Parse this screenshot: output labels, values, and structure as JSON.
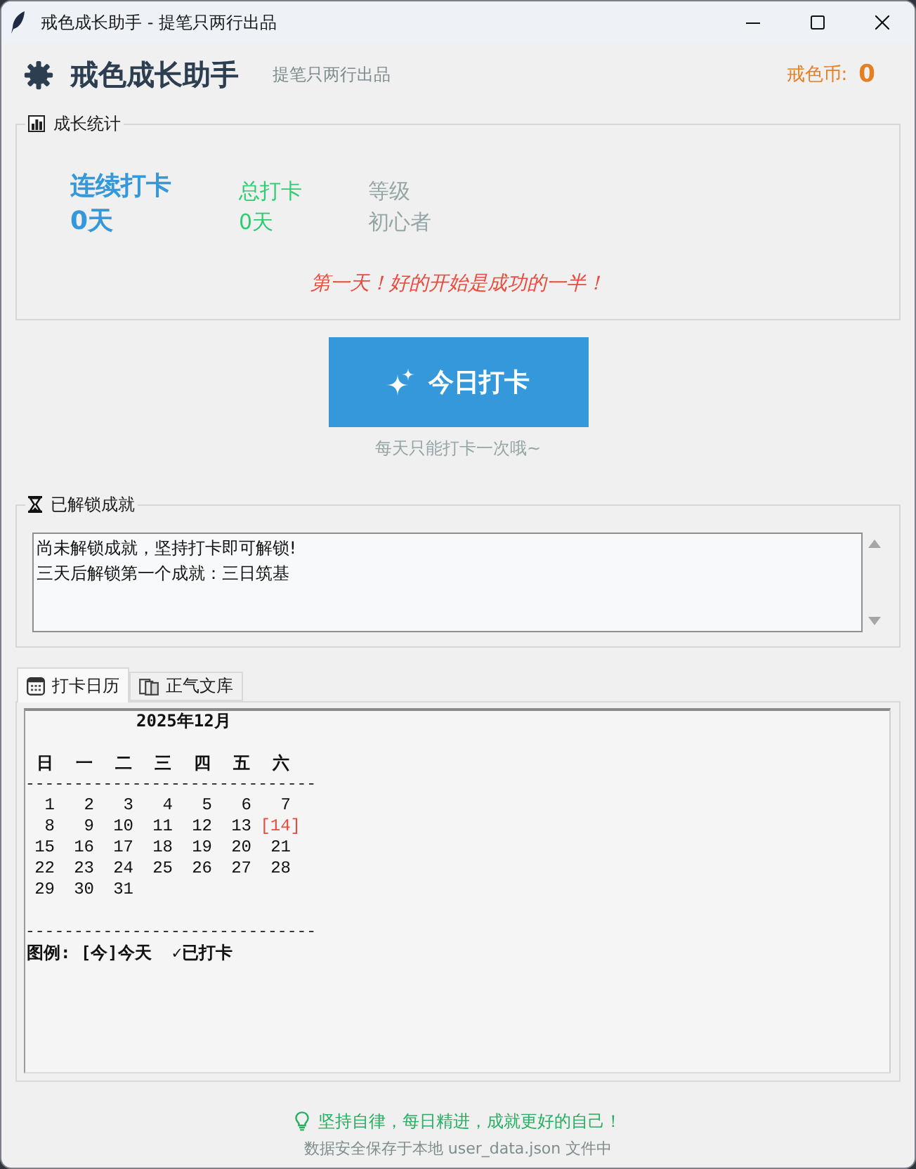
{
  "window": {
    "title": "戒色成长助手 - 提笔只两行出品"
  },
  "header": {
    "title": "戒色成长助手",
    "subtitle": "提笔只两行出品",
    "coins_label": "戒色币:",
    "coins": "0"
  },
  "stats": {
    "title": "成长统计",
    "items": [
      {
        "kind": "streak",
        "label": "连续打卡",
        "value": "0天"
      },
      {
        "kind": "total",
        "label": "总打卡",
        "value": "0天"
      },
      {
        "kind": "level",
        "label": "等级",
        "value": "初心者"
      }
    ],
    "message": "第一天！好的开始是成功的一半！"
  },
  "checkin": {
    "button": "今日打卡",
    "hint": "每天只能打卡一次哦~"
  },
  "achievements": {
    "title": "已解锁成就",
    "lines": [
      "尚未解锁成就，坚持打卡即可解锁!",
      "三天后解锁第一个成就：三日筑基"
    ]
  },
  "tabs": [
    {
      "label": "打卡日历",
      "selected": true
    },
    {
      "label": "正气文库",
      "selected": false
    }
  ],
  "calendar": {
    "month": "2025年12月",
    "weekdays": [
      "日",
      "一",
      "二",
      "三",
      "四",
      "五",
      "六"
    ],
    "rule_top": "------------------------------",
    "weeks": [
      [
        {
          "day": "1",
          "today": false
        },
        {
          "day": "2",
          "today": false
        },
        {
          "day": "3",
          "today": false
        },
        {
          "day": "4",
          "today": false
        },
        {
          "day": "5",
          "today": false
        },
        {
          "day": "6",
          "today": false
        },
        {
          "day": "7",
          "today": false
        }
      ],
      [
        {
          "day": "8",
          "today": false
        },
        {
          "day": "9",
          "today": false
        },
        {
          "day": "10",
          "today": false
        },
        {
          "day": "11",
          "today": false
        },
        {
          "day": "12",
          "today": false
        },
        {
          "day": "13",
          "today": false
        },
        {
          "day": "[14]",
          "today": true
        }
      ],
      [
        {
          "day": "15",
          "today": false
        },
        {
          "day": "16",
          "today": false
        },
        {
          "day": "17",
          "today": false
        },
        {
          "day": "18",
          "today": false
        },
        {
          "day": "19",
          "today": false
        },
        {
          "day": "20",
          "today": false
        },
        {
          "day": "21",
          "today": false
        }
      ],
      [
        {
          "day": "22",
          "today": false
        },
        {
          "day": "23",
          "today": false
        },
        {
          "day": "24",
          "today": false
        },
        {
          "day": "25",
          "today": false
        },
        {
          "day": "26",
          "today": false
        },
        {
          "day": "27",
          "today": false
        },
        {
          "day": "28",
          "today": false
        }
      ],
      [
        {
          "day": "29",
          "today": false
        },
        {
          "day": "30",
          "today": false
        },
        {
          "day": "31",
          "today": false
        }
      ]
    ],
    "rule_bottom": "------------------------------",
    "legend": "图例: [今]今天  ✓已打卡"
  },
  "footer": {
    "motto": "坚持自律，每日精进，成就更好的自己！",
    "note": "数据安全保存于本地 user_data.json 文件中"
  }
}
